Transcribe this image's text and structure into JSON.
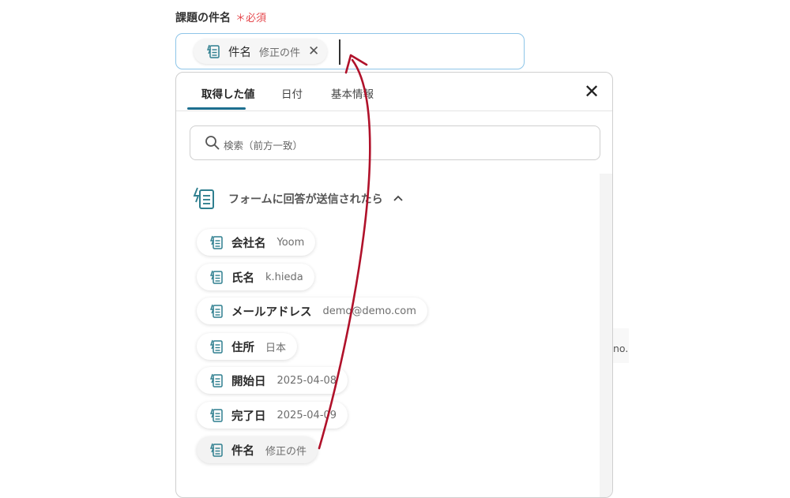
{
  "field": {
    "label": "課題の件名",
    "required_label": "＊必須",
    "chip": {
      "label": "件名",
      "value": "修正の件",
      "remove_glyph": "✕",
      "icon": "form-icon"
    }
  },
  "panel": {
    "tabs": [
      {
        "label": "取得した値",
        "active": true
      },
      {
        "label": "日付",
        "active": false
      },
      {
        "label": "基本情報",
        "active": false
      }
    ],
    "close_glyph": "✕",
    "search": {
      "placeholder": "検索（前方一致）",
      "icon": "search-icon"
    },
    "section": {
      "title": "フォームに回答が送信されたら",
      "chevron": "⌃",
      "icon": "form-icon"
    },
    "items": [
      {
        "label": "会社名",
        "value": "Yoom"
      },
      {
        "label": "氏名",
        "value": "k.hieda"
      },
      {
        "label": "メールアドレス",
        "value": "demo@demo.com"
      },
      {
        "label": "住所",
        "value": "日本"
      },
      {
        "label": "開始日",
        "value": "2025-04-08"
      },
      {
        "label": "完了日",
        "value": "2025-04-09"
      },
      {
        "label": "件名",
        "value": "修正の件"
      }
    ]
  },
  "background": {
    "fragment_text": "no."
  },
  "colors": {
    "accent": "#1d6f8f",
    "required": "#e5484d",
    "arrow": "#b0112a",
    "focus_border": "#8ec5e8"
  }
}
